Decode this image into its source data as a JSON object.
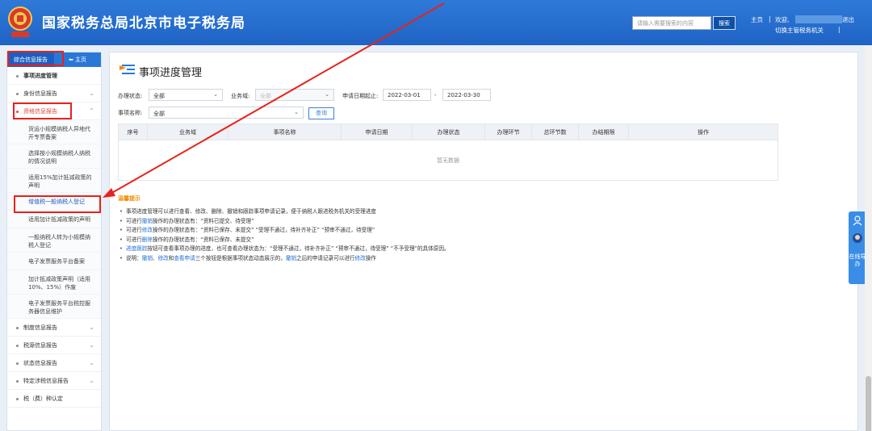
{
  "header": {
    "title": "国家税务总局北京市电子税务局",
    "search_placeholder": "请输入需要搜索的内容",
    "search_label": "搜索",
    "home_label": "主页",
    "welcome_label": "欢迎,",
    "logout_label": "退出",
    "switch_label": "切换主管税务机关"
  },
  "sidebar": {
    "tab_active": "综合信息报告",
    "tab_home": "主页",
    "items": [
      {
        "label": "事项进度管理"
      },
      {
        "label": "身份信息报告"
      },
      {
        "label": "资格信息报告"
      },
      {
        "label": "制度信息报告"
      },
      {
        "label": "税源信息报告"
      },
      {
        "label": "状态信息报告"
      },
      {
        "label": "特定涉税信息报告"
      },
      {
        "label": "税（费）种认定"
      }
    ],
    "subitems": [
      {
        "label": "货运小规模纳税人异地代开专票备案"
      },
      {
        "label": "选择按小规模纳税人纳税的情况说明"
      },
      {
        "label": "适用15%加计抵减政策的声明"
      },
      {
        "label": "增值税一般纳税人登记"
      },
      {
        "label": "适用加计抵减政策的声明"
      },
      {
        "label": "一般纳税人转为小规模纳税人登记"
      },
      {
        "label": "电子发票服务平台备案"
      },
      {
        "label": "加计抵减政策声明（适用10%、15%）作废"
      },
      {
        "label": "电子发票服务平台税控服务器信息维护"
      }
    ]
  },
  "main": {
    "title": "事项进度管理",
    "filters": {
      "status_label": "办理状态:",
      "status_value": "全部",
      "domain_label": "业务域:",
      "domain_value": "全部",
      "date_label": "申请日期起止:",
      "date_start": "2022-03-01",
      "date_sep": "-",
      "date_end": "2022-03-30",
      "item_label": "事项名称:",
      "item_value": "全部",
      "query_label": "查询"
    },
    "table": {
      "columns": [
        "序号",
        "业务域",
        "事项名称",
        "申请日期",
        "办理状态",
        "办理环节",
        "总环节数",
        "办结期限",
        "操作"
      ],
      "empty_text": "暂无数据"
    },
    "tips_title": "温馨提示",
    "tips": [
      {
        "parts": [
          "事项进度管理可以进行查看、修改、删除、撤销和跟踪事项申请记录，便于纳税人跟进税务机关的受理进度"
        ]
      },
      {
        "parts": [
          "可进行",
          "撤销",
          "操作的办理状态有：“资料已提交、待受理”"
        ]
      },
      {
        "parts": [
          "可进行",
          "修改",
          "操作的办理状态有：“资料已保存、未提交” “受理不通过，待补齐补正” “预审不通过，待受理”"
        ]
      },
      {
        "parts": [
          "可进行",
          "删除",
          "操作的办理状态有：“资料已保存、未提交”"
        ]
      },
      {
        "parts": [
          "进度跟踪",
          "按钮可查看事项办理的进度，也可查看办理状态为：“受理不通过，待补齐补正” “预审不通过，待受理” “不予受理”的具体原因。"
        ]
      },
      {
        "parts": [
          "说明：",
          "撤销",
          "、",
          "修改",
          "和",
          "查看申请",
          "三个按钮是根据事项状态动态展示的，",
          "撤销",
          "之后的申请记录可以进行",
          "修改",
          "操作"
        ]
      }
    ]
  },
  "side_widget": {
    "label": "在线导办"
  },
  "colors": {
    "header_blue": "#2373d0",
    "annotation_red": "#e8221b",
    "link_blue": "#1d6fd8",
    "tip_orange": "#f08a00"
  }
}
